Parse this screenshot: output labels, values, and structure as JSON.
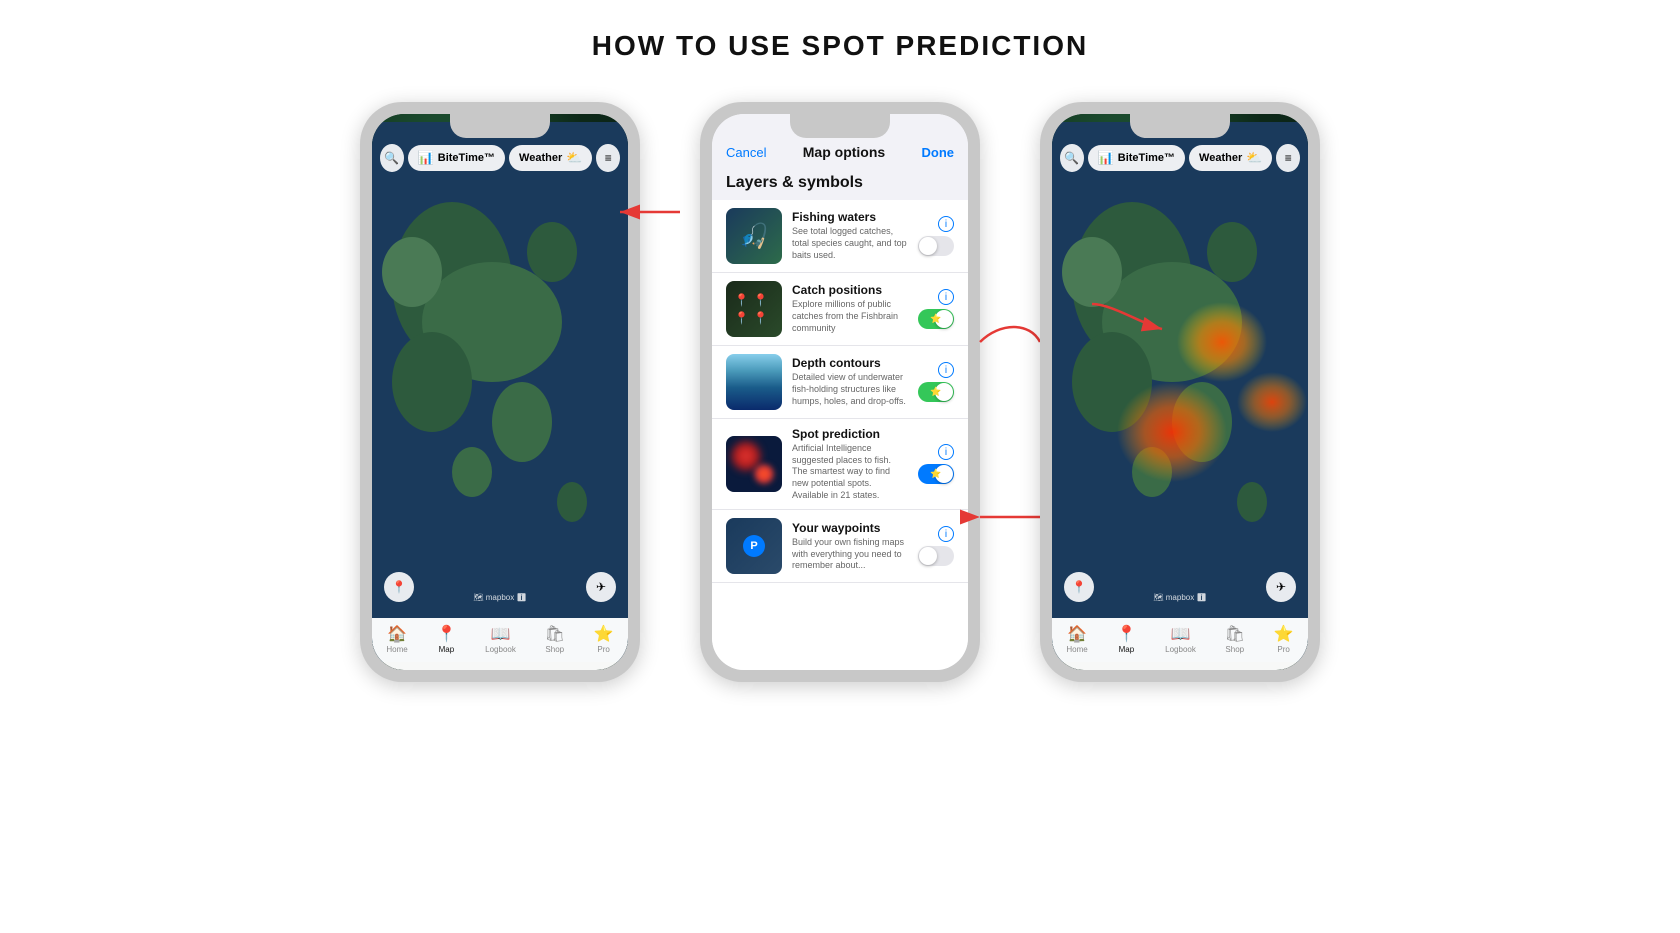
{
  "title": "HOW TO USE SPOT PREDICTION",
  "phone1": {
    "header": {
      "search_icon": "🔍",
      "bitetime_label": "BiteTime™",
      "bitetime_icon": "📊",
      "weather_label": "Weather",
      "weather_icon": "⛅",
      "layers_icon": "≡"
    },
    "bottom": {
      "mapbox_label": "🗺 mapbox",
      "info_icon": "ℹ",
      "location_icon": "📍",
      "navigate_icon": "✈"
    },
    "tabs": [
      {
        "label": "Home",
        "icon": "🏠",
        "active": false
      },
      {
        "label": "Map",
        "icon": "📍",
        "active": true
      },
      {
        "label": "Logbook",
        "icon": "📖",
        "active": false
      },
      {
        "label": "Shop",
        "icon": "🛍",
        "active": false
      },
      {
        "label": "Pro",
        "icon": "⭐",
        "active": false
      }
    ]
  },
  "phone2": {
    "header": {
      "cancel_label": "Cancel",
      "title_label": "Map options",
      "done_label": "Done"
    },
    "section_title": "Layers & symbols",
    "layers": [
      {
        "name": "Fishing waters",
        "desc": "See total logged catches, total species caught, and top baits used.",
        "toggle_state": "off",
        "thumb_type": "fishing"
      },
      {
        "name": "Catch positions",
        "desc": "Explore millions of public catches from the Fishbrain community",
        "toggle_state": "on",
        "thumb_type": "catch"
      },
      {
        "name": "Depth contours",
        "desc": "Detailed view of underwater fish-holding structures like humps, holes, and drop-offs.",
        "toggle_state": "on",
        "thumb_type": "depth"
      },
      {
        "name": "Spot prediction",
        "desc": "Artificial Intelligence suggested places to fish. The smartest way to find new potential spots. Available in 21 states.",
        "toggle_state": "on-blue",
        "thumb_type": "spot"
      },
      {
        "name": "Your waypoints",
        "desc": "Build your own fishing maps with everything you need to remember about...",
        "toggle_state": "off",
        "thumb_type": "waypoints"
      }
    ]
  },
  "phone3": {
    "header": {
      "search_icon": "🔍",
      "bitetime_label": "BiteTime™",
      "bitetime_icon": "📊",
      "weather_label": "Weather",
      "weather_icon": "⛅",
      "layers_icon": "≡"
    },
    "tabs": [
      {
        "label": "Home",
        "icon": "🏠",
        "active": false
      },
      {
        "label": "Map",
        "icon": "📍",
        "active": true
      },
      {
        "label": "Logbook",
        "icon": "📖",
        "active": false
      },
      {
        "label": "Shop",
        "icon": "🛍",
        "active": false
      },
      {
        "label": "Pro",
        "icon": "⭐",
        "active": false
      }
    ]
  }
}
